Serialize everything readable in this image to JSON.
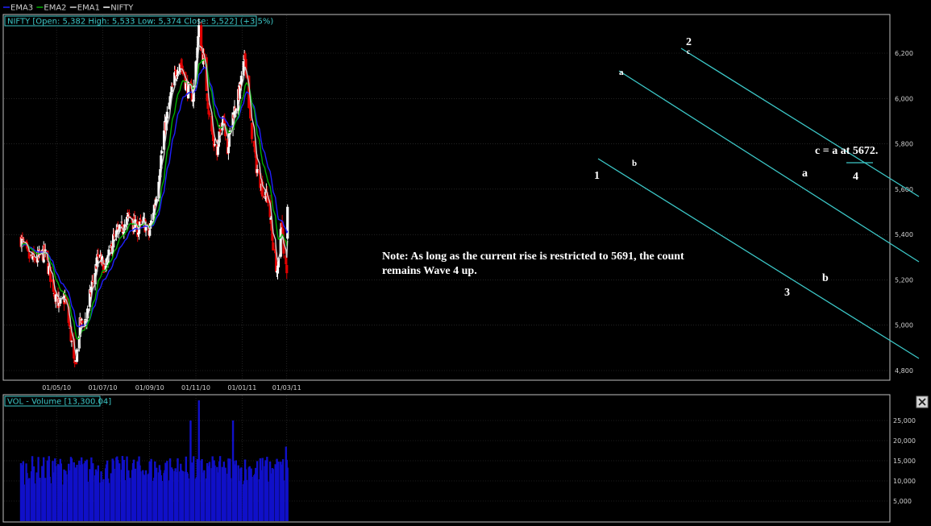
{
  "colors": {
    "background": "#000000",
    "frame": "#bfbfbf",
    "grid": "#3a3a3a",
    "up_candle": "#ffffff",
    "down_candle": "#e00000",
    "ema3": "#2020ff",
    "ema2": "#00b000",
    "ema1": "#d0d0d0",
    "channel": "#3cc8c8",
    "volume": "#1010c8"
  },
  "legend": {
    "items": [
      {
        "label": "EMA3",
        "color": "#2020ff"
      },
      {
        "label": "EMA2",
        "color": "#00b000"
      },
      {
        "label": "EMA1",
        "color": "#d0d0d0"
      },
      {
        "label": "NIFTY",
        "color": "#ffffff"
      }
    ]
  },
  "price_panel": {
    "info_box": "NIFTY [Open: 5,382  High: 5,533  Low: 5,374  Close: 5,522] (+3.5%)"
  },
  "volume_panel": {
    "info_box": "VOL - Volume [13,300.04]",
    "close_icon": "close-icon"
  },
  "annotations": {
    "note_line1": "Note: As long as the current rise is restricted to 5691, the count",
    "note_line2": "remains Wave 4 up.",
    "target": "c = a at 5672.",
    "wave_labels": [
      "1",
      "2",
      "3",
      "4",
      "a",
      "b",
      "c",
      "a",
      "b",
      "a",
      "b"
    ]
  },
  "chart_data": [
    {
      "type": "candlestick",
      "title": "NIFTY",
      "x_tick_labels": [
        "01/05/10",
        "01/07/10",
        "01/09/10",
        "01/11/10",
        "01/01/11",
        "01/03/11"
      ],
      "y_tick_labels": [
        "4,800",
        "5,000",
        "5,200",
        "5,400",
        "5,600",
        "5,800",
        "6,000",
        "6,200"
      ],
      "ylim": [
        4780,
        6290
      ],
      "grid": true,
      "legend_position": "top-left",
      "last_bar": {
        "open": 5382,
        "high": 5533,
        "low": 5374,
        "close": 5522,
        "change": "+3.5%"
      },
      "close_path": [
        {
          "date": "2010-03-15",
          "close": 5380
        },
        {
          "date": "2010-03-25",
          "close": 5300
        },
        {
          "date": "2010-04-05",
          "close": 5290
        },
        {
          "date": "2010-04-15",
          "close": 5320
        },
        {
          "date": "2010-04-26",
          "close": 5180
        },
        {
          "date": "2010-05-05",
          "close": 5080
        },
        {
          "date": "2010-05-12",
          "close": 5120
        },
        {
          "date": "2010-05-20",
          "close": 4950
        },
        {
          "date": "2010-05-25",
          "close": 4800
        },
        {
          "date": "2010-06-01",
          "close": 5000
        },
        {
          "date": "2010-06-10",
          "close": 5030
        },
        {
          "date": "2010-06-15",
          "close": 5150
        },
        {
          "date": "2010-06-25",
          "close": 5300
        },
        {
          "date": "2010-07-05",
          "close": 5250
        },
        {
          "date": "2010-07-15",
          "close": 5380
        },
        {
          "date": "2010-07-25",
          "close": 5420
        },
        {
          "date": "2010-08-05",
          "close": 5480
        },
        {
          "date": "2010-08-15",
          "close": 5420
        },
        {
          "date": "2010-08-25",
          "close": 5450
        },
        {
          "date": "2010-08-31",
          "close": 5400
        },
        {
          "date": "2010-09-10",
          "close": 5580
        },
        {
          "date": "2010-09-20",
          "close": 5850
        },
        {
          "date": "2010-09-30",
          "close": 6030
        },
        {
          "date": "2010-10-10",
          "close": 6180
        },
        {
          "date": "2010-10-20",
          "close": 6050
        },
        {
          "date": "2010-10-28",
          "close": 6010
        },
        {
          "date": "2010-11-05",
          "close": 6300
        },
        {
          "date": "2010-11-12",
          "close": 6150
        },
        {
          "date": "2010-11-20",
          "close": 5880
        },
        {
          "date": "2010-11-29",
          "close": 5750
        },
        {
          "date": "2010-12-07",
          "close": 5950
        },
        {
          "date": "2010-12-13",
          "close": 5780
        },
        {
          "date": "2010-12-20",
          "close": 5930
        },
        {
          "date": "2010-12-28",
          "close": 6020
        },
        {
          "date": "2011-01-05",
          "close": 6180
        },
        {
          "date": "2011-01-12",
          "close": 5900
        },
        {
          "date": "2011-01-20",
          "close": 5700
        },
        {
          "date": "2011-01-28",
          "close": 5600
        },
        {
          "date": "2011-02-05",
          "close": 5550
        },
        {
          "date": "2011-02-10",
          "close": 5380
        },
        {
          "date": "2011-02-17",
          "close": 5220
        },
        {
          "date": "2011-02-22",
          "close": 5480
        },
        {
          "date": "2011-02-25",
          "close": 5300
        },
        {
          "date": "2011-03-01",
          "close": 5250
        },
        {
          "date": "2011-03-02",
          "close": 5522
        }
      ],
      "series": [
        {
          "name": "EMA3"
        },
        {
          "name": "EMA2"
        },
        {
          "name": "EMA1"
        },
        {
          "name": "NIFTY"
        }
      ]
    },
    {
      "type": "bar",
      "title": "VOL - Volume",
      "current_value": 13300.04,
      "y_tick_labels": [
        "5,000",
        "10,000",
        "15,000",
        "20,000",
        "25,000"
      ],
      "ylim": [
        0,
        30000
      ],
      "typical_value": 13000,
      "notable_bars": [
        {
          "date": "2010-10-25",
          "value": 25000
        },
        {
          "date": "2010-11-05",
          "value": 30000
        },
        {
          "date": "2010-12-20",
          "value": 25000
        },
        {
          "date": "2011-02-28",
          "value": 18500
        }
      ]
    }
  ]
}
